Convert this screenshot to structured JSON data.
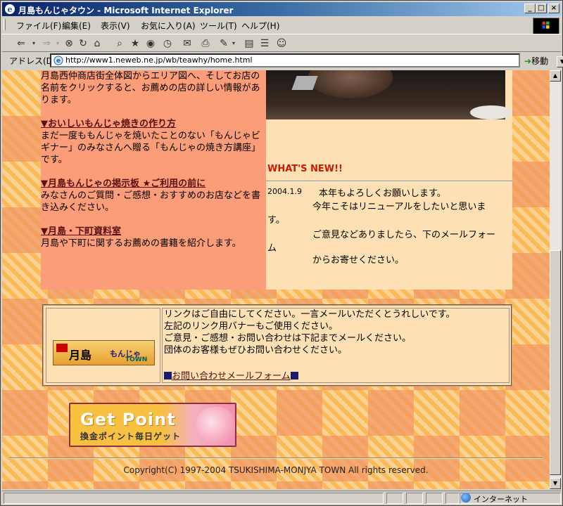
{
  "window": {
    "title": "月島もんじゃタウン - Microsoft Internet Explorer",
    "minimize": "_",
    "maximize": "□",
    "close": "×"
  },
  "menu": [
    "ファイル(F)",
    "編集(E)",
    "表示(V)",
    "お気に入り(A)",
    "ツール(T)",
    "ヘルプ(H)"
  ],
  "address": {
    "label": "アドレス(D)",
    "url": "http://www1.neweb.ne.jp/wb/teawhy/home.html",
    "go_label": "移動"
  },
  "left": {
    "intro": "月島西仲商店街全体図からエリア図へ、そしてお店の名前をクリックすると、お薦めの店の詳しい情報があります。",
    "sections": [
      {
        "title": "▼おいしいもんじゃ焼きの作り方",
        "body": "まだ一度ももんじゃを焼いたことのない「もんじゃビギナー」のみなさんへ贈る「もんじゃの焼き方講座」です。"
      },
      {
        "title": "▼月島もんじゃの掲示板  ★ご利用の前に",
        "body": "みなさんのご質問・ご感想・おすすめのお店などを書き込みください。"
      },
      {
        "title": "▼月島・下町資料室",
        "body": "月島や下町に関するお薦めの書籍を紹介します。"
      }
    ]
  },
  "news": {
    "heading": "WHAT'S NEW!!",
    "date": "2004.1.9",
    "line1": "本年もよろしくお願いします。",
    "line2": "今年こそはリニューアルをしたいと思いま",
    "line2b": "す。",
    "line3": "ご意見などありましたら、下のメールフォー",
    "line3b": "ム",
    "line4": "からお寄せください。"
  },
  "linkbox": {
    "banner_title": "月島",
    "banner_sub": "もんじゃ",
    "banner_town": "TOWN",
    "lines": [
      "リンクはご自由にしてください。一言メールいただくとうれしいです。",
      "左記のリンク用バナーもご使用ください。",
      "ご意見・ご感想・お問い合わせは下記までメールください。",
      "団体のお客様もぜひお問い合わせください。"
    ],
    "mail_link": "お問い合わせメールフォーム"
  },
  "getpoint": {
    "title": "Get Point",
    "sub": "換金ポイント毎日ゲット"
  },
  "footer": {
    "copyright": "Copyright(C) 1997-2004 TSUKISHIMA-MONJYA TOWN All rights reserved."
  },
  "status": {
    "zone": "インターネット"
  }
}
